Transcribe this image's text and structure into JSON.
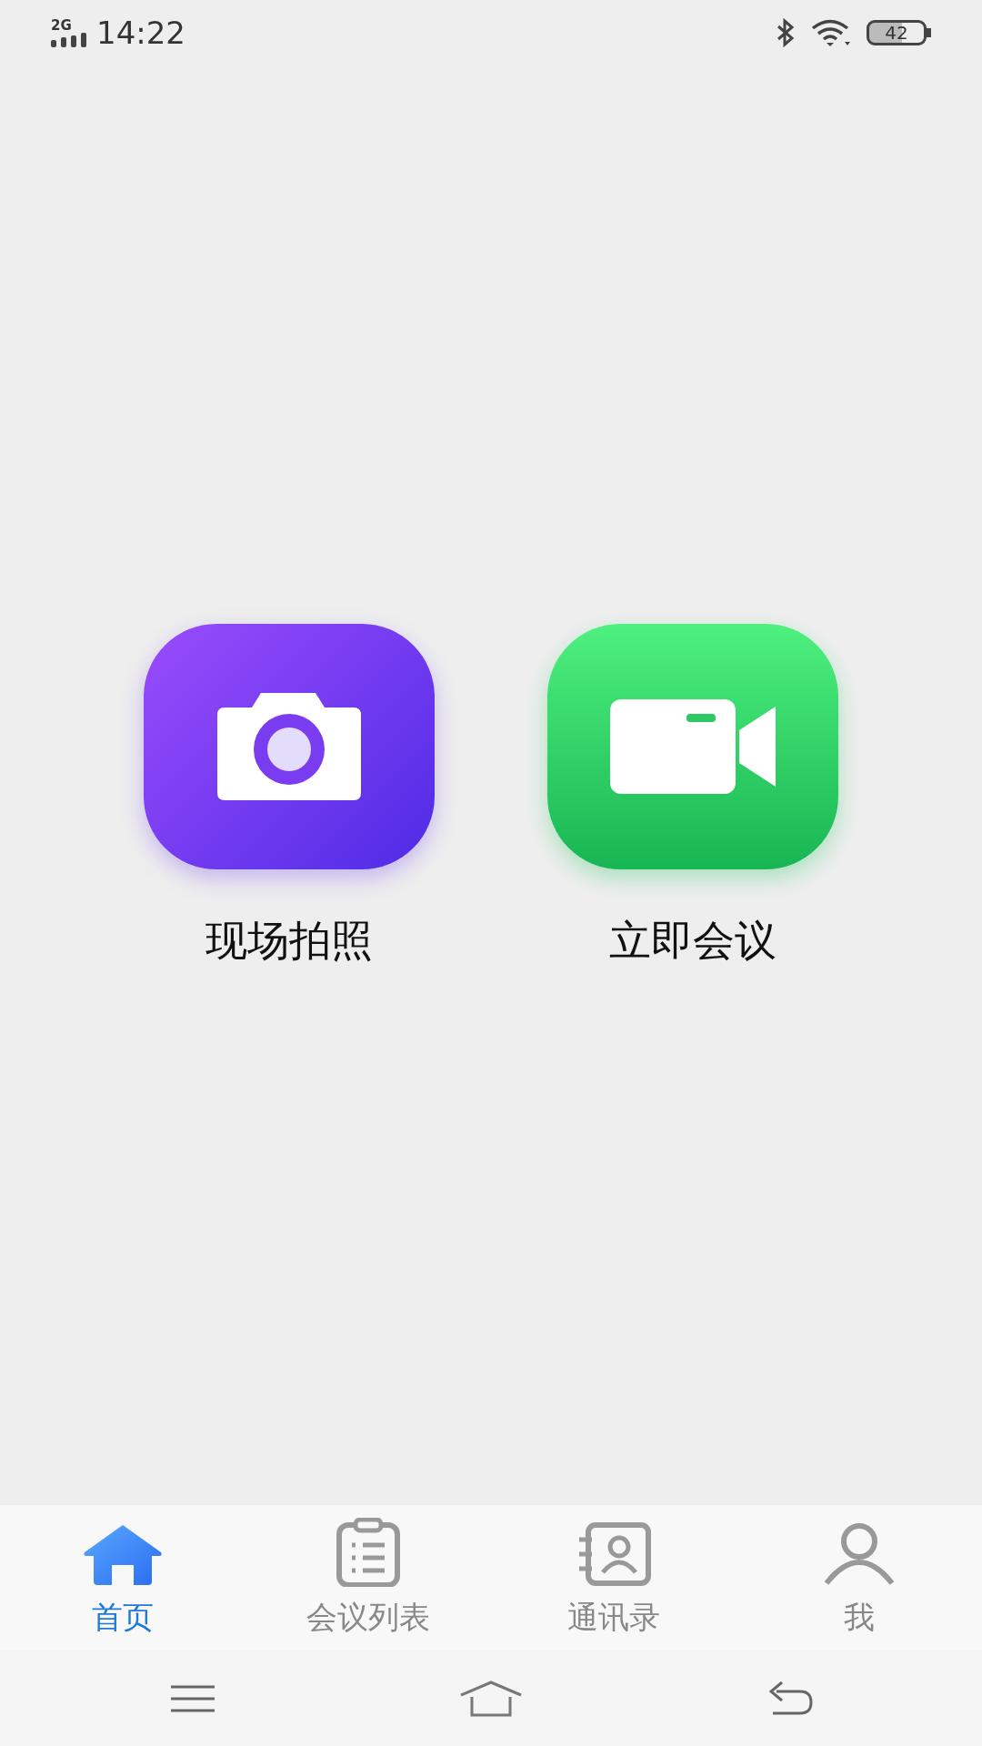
{
  "status_bar": {
    "network": "2G",
    "time": "14:22",
    "battery": "42"
  },
  "actions": [
    {
      "label": "现场拍照",
      "kind": "camera"
    },
    {
      "label": "立即会议",
      "kind": "video"
    }
  ],
  "tabs": [
    {
      "label": "首页",
      "kind": "home",
      "selected": true
    },
    {
      "label": "会议列表",
      "kind": "list",
      "selected": false
    },
    {
      "label": "通讯录",
      "kind": "contacts",
      "selected": false
    },
    {
      "label": "我",
      "kind": "profile",
      "selected": false
    }
  ]
}
